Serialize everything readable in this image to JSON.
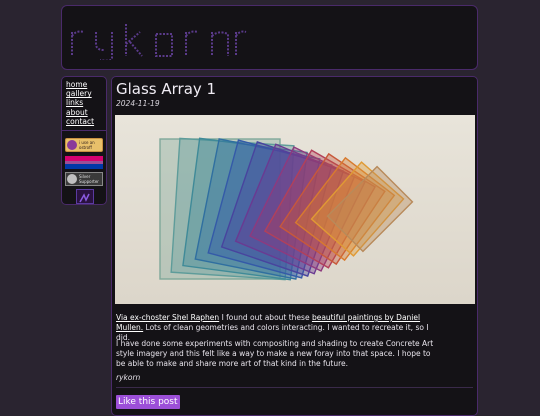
{
  "site": {
    "logo_text": "rykorn"
  },
  "nav": {
    "items": [
      {
        "label": "home"
      },
      {
        "label": "gallery"
      },
      {
        "label": "links"
      },
      {
        "label": "about"
      },
      {
        "label": "contact"
      }
    ]
  },
  "badges": {
    "badge1_line1": "i use an",
    "badge1_line2": "ostroff",
    "badge3_line1": "Silver",
    "badge3_line2": "Supporter"
  },
  "post": {
    "title": "Glass Array 1",
    "date": "2024-11-19",
    "p1_link1": "Via ex-choster Shel Raphen",
    "p1_text1": " I found out about these ",
    "p1_link2": "beautiful paintings by Daniel Mullen.",
    "p1_text2": " Lots of clean geometries and colors interacting. I wanted to recreate it, so I did.",
    "p2": "I have done some experiments with compositing and shading to create Concrete Art style imagery and this felt like a way to make a new foray into that space. I hope to be able to make and share more art of that kind in the future.",
    "author": "rykorn",
    "like_label": "Like this post"
  },
  "colors": {
    "accent": "#9c4fd8",
    "border": "#4a2a6a",
    "panel": "#141216",
    "background": "#2a2430"
  }
}
